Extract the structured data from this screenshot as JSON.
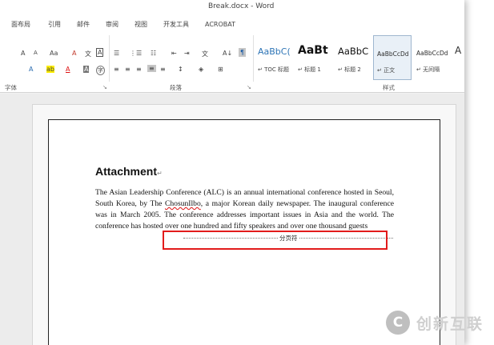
{
  "window": {
    "title": "Break.docx - Word"
  },
  "tabs": [
    "面布局",
    "引用",
    "邮件",
    "审阅",
    "视图",
    "开发工具",
    "ACROBAT"
  ],
  "ribbon": {
    "font": {
      "grow": "A",
      "shrink": "A",
      "change_case": "Aa",
      "clear_format": "A",
      "phonetic": "文",
      "char_border": "A",
      "text_effect": "A",
      "highlight": "ab",
      "font_color": "A",
      "char_shade": "A",
      "enclose": "字",
      "group_label": "字体"
    },
    "paragraph": {
      "bullets": "☰",
      "numbering": "⋮☰",
      "multilevel": "☷",
      "decrease_indent": "⇤",
      "increase_indent": "⇥",
      "asian_layout": "文",
      "sort": "A↓",
      "show_marks": "¶",
      "align_left": "≡",
      "align_center": "≡",
      "align_right": "≡",
      "justify": "≡",
      "distributed": "≡",
      "line_spacing": "↕",
      "shading": "◈",
      "borders": "⊞",
      "group_label": "段落"
    },
    "styles": {
      "group_label": "样式",
      "items": [
        {
          "sample": "AaBbC(",
          "name": "↵ TOC 标题"
        },
        {
          "sample": "AaBt",
          "name": "↵ 标题 1"
        },
        {
          "sample": "AaBbC",
          "name": "↵ 标题 2"
        },
        {
          "sample": "AaBbCcDd",
          "name": "↵ 正文"
        },
        {
          "sample": "AaBbCcDd",
          "name": "↵ 无间隔"
        },
        {
          "sample": "A",
          "name": ""
        }
      ]
    }
  },
  "document": {
    "heading": "Attachment",
    "heading_mark": "↵",
    "body_part1": "The Asian Leadership Conference (ALC) is an annual international conference hosted in Seoul, South Korea, by The ",
    "body_misspelled": "ChosunIlbo",
    "body_part2": ", a major Korean daily newspaper. The inaugural conference was in March 2005. The conference addresses important issues in Asia and the world. The conference has hosted over one hundred and fifty speakers and over one thousand guests",
    "page_break_label": "分页符"
  },
  "watermark": {
    "logo": "C",
    "text": "创新互联"
  },
  "colors": {
    "highlight_box": "#e21b1b",
    "spelling_error": "#dd1111"
  }
}
